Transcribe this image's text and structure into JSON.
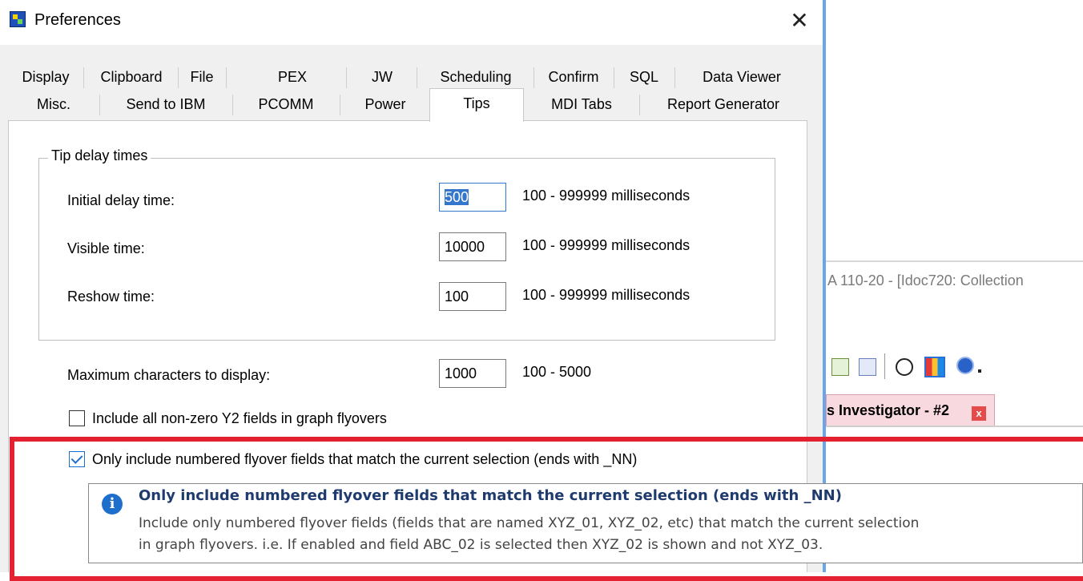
{
  "dialog": {
    "title": "Preferences",
    "close_glyph": "✕",
    "tabs_row1": [
      "Display",
      "Clipboard",
      "File",
      "PEX",
      "JW",
      "Scheduling",
      "Confirm",
      "SQL",
      "Data Viewer"
    ],
    "tabs_row2": [
      "Misc.",
      "Send to IBM",
      "PCOMM",
      "Power",
      "Tips",
      "MDI Tabs",
      "Report Generator"
    ],
    "active_tab": "Tips"
  },
  "tips": {
    "group_title": "Tip delay times",
    "initial_label": "Initial delay time:",
    "initial_value": "500",
    "initial_range": "100 - 999999 milliseconds",
    "visible_label": "Visible time:",
    "visible_value": "10000",
    "visible_range": "100 - 999999 milliseconds",
    "reshow_label": "Reshow time:",
    "reshow_value": "100",
    "reshow_range": "100 - 999999 milliseconds",
    "maxchars_label": "Maximum characters to display:",
    "maxchars_value": "1000",
    "maxchars_range": "100 - 5000",
    "check_y2_label": "Include all non-zero Y2 fields in graph flyovers",
    "check_y2_checked": false,
    "check_numbered_label": "Only include numbered flyover fields that match the current selection (ends with _NN)",
    "check_numbered_checked": true
  },
  "tooltip": {
    "title": "Only include numbered flyover fields that match the current selection (ends with _NN)",
    "line1": "Include only numbered flyover fields (fields that are named XYZ_01, XYZ_02, etc) that match the current selection",
    "line2": "in graph flyovers.  i.e.  If enabled and field ABC_02 is selected then XYZ_02 is shown and not XYZ_03."
  },
  "background_window": {
    "title_fragment": "A 110-20 - [Idoc720:  Collection",
    "tab_label": "s Investigator - #2",
    "tab_close": "x"
  },
  "colors": {
    "highlight": "#e32131",
    "accent": "#1e6fcc"
  }
}
